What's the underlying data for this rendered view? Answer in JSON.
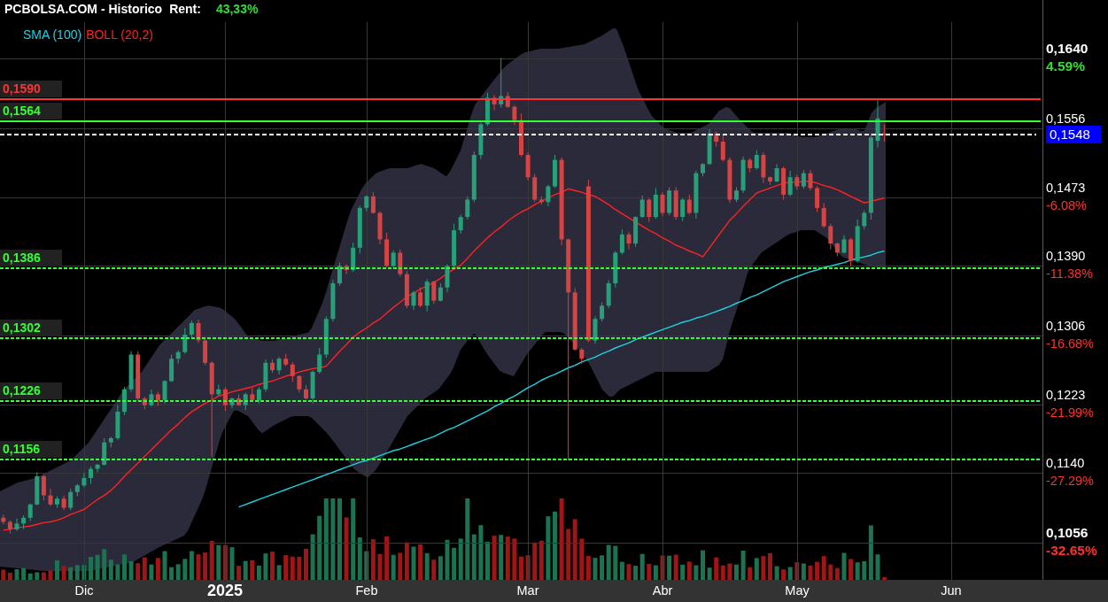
{
  "header": {
    "title": "PCBOLSA.COM - Historico",
    "rent_label": "Rent:",
    "rent_value": "43,33%"
  },
  "plot": {
    "chart_data": {
      "type": "candlestick",
      "grid": true,
      "ylim": [
        0.1011,
        0.1711
      ],
      "categories": [
        null,
        null,
        null,
        null,
        null,
        null,
        null,
        null,
        null,
        null,
        null,
        null,
        "Dic",
        null,
        null,
        null,
        null,
        null,
        null,
        null,
        null,
        null,
        null,
        null,
        null,
        null,
        null,
        null,
        null,
        null,
        null,
        null,
        null,
        "2025",
        null,
        null,
        null,
        null,
        null,
        null,
        null,
        null,
        null,
        null,
        null,
        null,
        null,
        null,
        null,
        null,
        null,
        null,
        null,
        null,
        "Feb",
        null,
        null,
        null,
        null,
        null,
        null,
        null,
        null,
        null,
        null,
        null,
        null,
        null,
        null,
        null,
        null,
        null,
        null,
        null,
        null,
        null,
        null,
        null,
        "Mar",
        null,
        null,
        null,
        null,
        null,
        null,
        null,
        null,
        null,
        null,
        null,
        null,
        null,
        null,
        null,
        null,
        null,
        null,
        null,
        "Abr",
        null,
        null,
        null,
        null,
        null,
        null,
        null,
        null,
        null,
        null,
        null,
        null,
        null,
        null,
        null,
        null,
        null,
        null,
        null,
        "May",
        null,
        null,
        null,
        null,
        null,
        null,
        null,
        null,
        null,
        null,
        null,
        null,
        null,
        null,
        null,
        null,
        null,
        null,
        null,
        null,
        null,
        null,
        "Jun",
        null,
        null,
        null,
        null,
        null,
        null,
        null,
        null,
        null,
        null,
        null,
        null,
        null
      ],
      "yticks": [
        {
          "value": 0.164,
          "label": "0,1640"
        },
        {
          "value": 0.1556,
          "label": "0,1556"
        },
        {
          "value": 0.1473,
          "label": "0,1473"
        },
        {
          "value": 0.139,
          "label": "0,1390"
        },
        {
          "value": 0.1306,
          "label": "0,1306"
        },
        {
          "value": 0.1223,
          "label": "0,1223"
        },
        {
          "value": 0.114,
          "label": "0,1140"
        },
        {
          "value": 0.1056,
          "label": "0,1056"
        }
      ],
      "ohlc": [
        [
          0.1086,
          0.109,
          0.1078,
          0.1081
        ],
        [
          0.1081,
          0.1083,
          0.1067,
          0.1072
        ],
        [
          0.1072,
          0.1085,
          0.107,
          0.1079
        ],
        [
          0.1079,
          0.1089,
          0.1072,
          0.1086
        ],
        [
          0.1086,
          0.1103,
          0.1082,
          0.1102
        ],
        [
          0.1102,
          0.1141,
          0.1101,
          0.1136
        ],
        [
          0.1136,
          0.1138,
          0.1107,
          0.1113
        ],
        [
          0.1113,
          0.1121,
          0.11,
          0.1102
        ],
        [
          0.1102,
          0.1112,
          0.1098,
          0.1109
        ],
        [
          0.1109,
          0.1113,
          0.1095,
          0.1098
        ],
        [
          0.1098,
          0.1121,
          0.1095,
          0.1117
        ],
        [
          0.1117,
          0.1127,
          0.1112,
          0.1125
        ],
        [
          0.1125,
          0.114,
          0.1123,
          0.1134
        ],
        [
          0.1134,
          0.1148,
          0.1127,
          0.1145
        ],
        [
          0.1145,
          0.1151,
          0.1141,
          0.115
        ],
        [
          0.115,
          0.1182,
          0.1149,
          0.1177
        ],
        [
          0.1177,
          0.1184,
          0.1171,
          0.1182
        ],
        [
          0.1182,
          0.1222,
          0.118,
          0.1214
        ],
        [
          0.1214,
          0.1244,
          0.121,
          0.1241
        ],
        [
          0.1241,
          0.1287,
          0.1238,
          0.1283
        ],
        [
          0.1283,
          0.1287,
          0.1227,
          0.123
        ],
        [
          0.123,
          0.1232,
          0.1217,
          0.1222
        ],
        [
          0.1222,
          0.1241,
          0.122,
          0.1235
        ],
        [
          0.1235,
          0.1238,
          0.1221,
          0.1228
        ],
        [
          0.1228,
          0.1252,
          0.1224,
          0.1251
        ],
        [
          0.1251,
          0.1283,
          0.125,
          0.1278
        ],
        [
          0.1278,
          0.1288,
          0.1272,
          0.1286
        ],
        [
          0.1286,
          0.1315,
          0.1284,
          0.1307
        ],
        [
          0.1307,
          0.1324,
          0.1303,
          0.1321
        ],
        [
          0.1321,
          0.1325,
          0.1297,
          0.13
        ],
        [
          0.13,
          0.1304,
          0.127,
          0.1273
        ],
        [
          0.1273,
          0.1275,
          0.116,
          0.1235
        ],
        [
          0.1235,
          0.1247,
          0.1233,
          0.1241
        ],
        [
          0.1241,
          0.1244,
          0.1215,
          0.1222
        ],
        [
          0.1222,
          0.1231,
          0.1218,
          0.123
        ],
        [
          0.123,
          0.1235,
          0.1221,
          0.1222
        ],
        [
          0.1222,
          0.1237,
          0.1216,
          0.1235
        ],
        [
          0.1235,
          0.1243,
          0.1226,
          0.1228
        ],
        [
          0.1228,
          0.1244,
          0.1224,
          0.1241
        ],
        [
          0.1241,
          0.1277,
          0.1238,
          0.1273
        ],
        [
          0.1273,
          0.1277,
          0.1261,
          0.1264
        ],
        [
          0.1264,
          0.128,
          0.1259,
          0.1278
        ],
        [
          0.1278,
          0.1284,
          0.1269,
          0.1271
        ],
        [
          0.1271,
          0.1274,
          0.125,
          0.1257
        ],
        [
          0.1257,
          0.1258,
          0.1237,
          0.1241
        ],
        [
          0.1241,
          0.1246,
          0.1229,
          0.123
        ],
        [
          0.123,
          0.1264,
          0.1224,
          0.1262
        ],
        [
          0.1262,
          0.1291,
          0.126,
          0.1283
        ],
        [
          0.1283,
          0.1329,
          0.1279,
          0.1326
        ],
        [
          0.1326,
          0.1373,
          0.1323,
          0.1369
        ],
        [
          0.1369,
          0.1394,
          0.1366,
          0.139
        ],
        [
          0.139,
          0.1392,
          0.138,
          0.1385
        ],
        [
          0.1385,
          0.1418,
          0.1383,
          0.1412
        ],
        [
          0.1412,
          0.1463,
          0.1405,
          0.146
        ],
        [
          0.146,
          0.1475,
          0.1456,
          0.1474
        ],
        [
          0.1474,
          0.1479,
          0.1453,
          0.1454
        ],
        [
          0.1454,
          0.1456,
          0.1416,
          0.1422
        ],
        [
          0.1422,
          0.143,
          0.1388,
          0.139
        ],
        [
          0.139,
          0.1409,
          0.1386,
          0.1406
        ],
        [
          0.1406,
          0.141,
          0.1377,
          0.138
        ],
        [
          0.138,
          0.1384,
          0.1339,
          0.1342
        ],
        [
          0.1342,
          0.136,
          0.1337,
          0.1358
        ],
        [
          0.1358,
          0.1364,
          0.134,
          0.1342
        ],
        [
          0.1342,
          0.1374,
          0.1335,
          0.1371
        ],
        [
          0.1371,
          0.1372,
          0.1344,
          0.1348
        ],
        [
          0.1348,
          0.1369,
          0.1347,
          0.1364
        ],
        [
          0.1364,
          0.1392,
          0.1358,
          0.139
        ],
        [
          0.139,
          0.1441,
          0.1388,
          0.1433
        ],
        [
          0.1433,
          0.1452,
          0.1429,
          0.1449
        ],
        [
          0.1449,
          0.1474,
          0.1446,
          0.147
        ],
        [
          0.147,
          0.1528,
          0.1467,
          0.1524
        ],
        [
          0.1524,
          0.1563,
          0.1519,
          0.1561
        ],
        [
          0.1561,
          0.1599,
          0.1559,
          0.1593
        ],
        [
          0.1593,
          0.1596,
          0.1578,
          0.1585
        ],
        [
          0.1585,
          0.1641,
          0.1581,
          0.1595
        ],
        [
          0.1595,
          0.16,
          0.1581,
          0.1582
        ],
        [
          0.1582,
          0.1584,
          0.156,
          0.1566
        ],
        [
          0.1566,
          0.1574,
          0.1522,
          0.1524
        ],
        [
          0.1524,
          0.1527,
          0.1493,
          0.1497
        ],
        [
          0.1497,
          0.1501,
          0.1467,
          0.147
        ],
        [
          0.147,
          0.1474,
          0.1464,
          0.1467
        ],
        [
          0.1467,
          0.1488,
          0.1462,
          0.1486
        ],
        [
          0.1486,
          0.1524,
          0.1484,
          0.1518
        ],
        [
          0.1518,
          0.1521,
          0.1415,
          0.1422
        ],
        [
          0.1422,
          0.1423,
          0.1155,
          0.1358
        ],
        [
          0.1358,
          0.1363,
          0.1288,
          0.1289
        ],
        [
          0.1289,
          0.1291,
          0.1272,
          0.1278
        ],
        [
          0.1486,
          0.1494,
          0.1298,
          0.13
        ],
        [
          0.13,
          0.1329,
          0.1296,
          0.1326
        ],
        [
          0.1326,
          0.1346,
          0.1323,
          0.1342
        ],
        [
          0.1342,
          0.1373,
          0.1339,
          0.1369
        ],
        [
          0.1369,
          0.1408,
          0.1364,
          0.1406
        ],
        [
          0.1406,
          0.1434,
          0.1404,
          0.1428
        ],
        [
          0.1428,
          0.1431,
          0.141,
          0.1417
        ],
        [
          0.1417,
          0.145,
          0.1413,
          0.1449
        ],
        [
          0.1449,
          0.1475,
          0.1448,
          0.147
        ],
        [
          0.147,
          0.1472,
          0.1443,
          0.1449
        ],
        [
          0.1449,
          0.1484,
          0.1447,
          0.1476
        ],
        [
          0.1476,
          0.1479,
          0.145,
          0.1454
        ],
        [
          0.1454,
          0.1485,
          0.1451,
          0.1481
        ],
        [
          0.1481,
          0.1485,
          0.1446,
          0.1449
        ],
        [
          0.1449,
          0.1472,
          0.1444,
          0.147
        ],
        [
          0.147,
          0.1476,
          0.1452,
          0.1454
        ],
        [
          0.1454,
          0.1505,
          0.1447,
          0.1502
        ],
        [
          0.1502,
          0.1514,
          0.1498,
          0.1513
        ],
        [
          0.1513,
          0.1555,
          0.1512,
          0.155
        ],
        [
          0.155,
          0.1552,
          0.1534,
          0.154
        ],
        [
          0.154,
          0.1548,
          0.1516,
          0.1518
        ],
        [
          0.1518,
          0.1521,
          0.1466,
          0.147
        ],
        [
          0.147,
          0.1485,
          0.1467,
          0.1481
        ],
        [
          0.1481,
          0.1522,
          0.1478,
          0.1518
        ],
        [
          0.1518,
          0.152,
          0.1503,
          0.1508
        ],
        [
          0.1508,
          0.153,
          0.1506,
          0.1524
        ],
        [
          0.1524,
          0.1527,
          0.149,
          0.1497
        ],
        [
          0.1497,
          0.1498,
          0.1488,
          0.1492
        ],
        [
          0.1492,
          0.1513,
          0.1491,
          0.1508
        ],
        [
          0.1508,
          0.151,
          0.147,
          0.1476
        ],
        [
          0.1476,
          0.1505,
          0.1474,
          0.1497
        ],
        [
          0.1497,
          0.15,
          0.1482,
          0.1486
        ],
        [
          0.1486,
          0.1506,
          0.1483,
          0.1502
        ],
        [
          0.1502,
          0.1506,
          0.1481,
          0.1484
        ],
        [
          0.1484,
          0.1486,
          0.1455,
          0.146
        ],
        [
          0.146,
          0.1466,
          0.1436,
          0.1438
        ],
        [
          0.1438,
          0.1441,
          0.141,
          0.1417
        ],
        [
          0.1417,
          0.1418,
          0.1402,
          0.1406
        ],
        [
          0.1406,
          0.1427,
          0.1405,
          0.1422
        ],
        [
          0.1422,
          0.1424,
          0.139,
          0.1396
        ],
        [
          0.1396,
          0.1446,
          0.1394,
          0.1438
        ],
        [
          0.1438,
          0.1457,
          0.1434,
          0.1454
        ],
        [
          0.1454,
          0.155,
          0.1446,
          0.1545
        ],
        [
          0.1541,
          0.159,
          0.1533,
          0.1568
        ],
        [
          0.155,
          0.1561,
          0.154,
          0.1548
        ],
        null,
        null,
        null,
        null,
        null,
        null,
        null,
        null,
        null,
        null,
        null,
        null,
        null,
        null,
        null,
        null,
        null,
        null,
        null,
        null,
        null,
        null,
        null
      ],
      "series": [
        {
          "name": "SMA (100)",
          "type": "line",
          "color": "#1ed2e2",
          "values": [
            null,
            null,
            null,
            null,
            null,
            null,
            null,
            null,
            null,
            null,
            null,
            null,
            null,
            null,
            null,
            null,
            null,
            null,
            null,
            null,
            null,
            null,
            null,
            null,
            null,
            null,
            null,
            null,
            null,
            null,
            null,
            null,
            null,
            null,
            null,
            0.1099,
            0.1102,
            0.1105,
            0.1108,
            0.1111,
            0.1114,
            0.1117,
            0.112,
            0.1123,
            0.1126,
            0.1129,
            0.1132,
            0.1135,
            0.1138,
            0.1141,
            0.1144,
            0.1147,
            0.115,
            0.1153,
            0.1155,
            0.1158,
            0.1161,
            0.1164,
            0.1167,
            0.1169,
            0.1172,
            0.1175,
            0.1178,
            0.1181,
            0.1184,
            0.1188,
            0.1192,
            0.1195,
            0.1199,
            0.1203,
            0.1207,
            0.1211,
            0.1215,
            0.122,
            0.1224,
            0.1229,
            0.1233,
            0.1238,
            0.1243,
            0.1247,
            0.1252,
            0.1256,
            0.1259,
            0.1263,
            0.1267,
            0.127,
            0.1274,
            0.1277,
            0.128,
            0.1284,
            0.1287,
            0.1291,
            0.1294,
            0.1297,
            0.1301,
            0.1304,
            0.1307,
            0.131,
            0.1313,
            0.1316,
            0.1319,
            0.1322,
            0.1324,
            0.1327,
            0.1329,
            0.1332,
            0.1335,
            0.1338,
            0.1341,
            0.1345,
            0.1348,
            0.1352,
            0.1355,
            0.1359,
            0.1363,
            0.1367,
            0.1371,
            0.1374,
            0.1377,
            0.138,
            0.1383,
            0.1385,
            0.1388,
            0.139,
            0.1392,
            0.1394,
            0.1397,
            0.1399,
            0.1401,
            0.1403,
            0.1406,
            0.1408,
            null,
            null,
            null,
            null,
            null,
            null,
            null,
            null,
            null,
            null,
            null,
            null,
            null,
            null,
            null,
            null,
            null,
            null,
            null,
            null,
            null,
            null,
            null
          ]
        },
        {
          "name": "BOLL (20,2)",
          "type": "line",
          "color": "#ff2222",
          "values": [
            0.1071,
            0.1072,
            0.1074,
            0.1075,
            0.1076,
            0.1078,
            0.108,
            0.1081,
            0.1083,
            0.1086,
            0.109,
            0.1093,
            0.1096,
            0.1102,
            0.1108,
            0.1113,
            0.1119,
            0.1127,
            0.1136,
            0.1144,
            0.1152,
            0.116,
            0.1168,
            0.1176,
            0.1184,
            0.1192,
            0.1199,
            0.1207,
            0.1214,
            0.1219,
            0.1224,
            0.1228,
            0.1233,
            0.1235,
            0.1238,
            0.124,
            0.1242,
            0.1244,
            0.1247,
            0.1249,
            0.1251,
            0.1254,
            0.1257,
            0.1259,
            0.1262,
            0.1264,
            0.1266,
            0.1267,
            0.1269,
            0.1278,
            0.1287,
            0.1295,
            0.1304,
            0.131,
            0.1315,
            0.1321,
            0.1326,
            0.1333,
            0.134,
            0.1346,
            0.1353,
            0.1357,
            0.1362,
            0.1366,
            0.137,
            0.1375,
            0.1381,
            0.1386,
            0.1391,
            0.1399,
            0.1408,
            0.1416,
            0.1424,
            0.1431,
            0.1437,
            0.1444,
            0.145,
            0.1455,
            0.1459,
            0.1464,
            0.1468,
            0.1472,
            0.1476,
            0.1479,
            0.1483,
            0.1481,
            0.1479,
            0.1476,
            0.1474,
            0.1469,
            0.1464,
            0.1458,
            0.1453,
            0.1448,
            0.1443,
            0.1438,
            0.1433,
            0.1429,
            0.1424,
            0.142,
            0.1415,
            0.1412,
            0.1408,
            0.1405,
            0.1401,
            0.1412,
            0.1423,
            0.1434,
            0.1445,
            0.1453,
            0.1462,
            0.147,
            0.1478,
            0.1481,
            0.1484,
            0.1487,
            0.149,
            0.1491,
            0.1491,
            0.1492,
            0.1492,
            0.149,
            0.1487,
            0.1485,
            0.1482,
            0.1478,
            0.1474,
            0.147,
            0.1466,
            0.1468,
            0.147,
            0.1472,
            null,
            null,
            null,
            null,
            null,
            null,
            null,
            null,
            null,
            null,
            null,
            null,
            null,
            null,
            null,
            null,
            null,
            null,
            null,
            null,
            null,
            null,
            null
          ]
        }
      ]
    }
  },
  "time_axis": [
    {
      "kind": "month"
    },
    {
      "kind": "year"
    },
    {
      "kind": "month"
    },
    {
      "kind": "month"
    },
    {
      "kind": "month"
    },
    {
      "kind": "month"
    },
    {
      "kind": "month"
    }
  ],
  "price_axis": [
    {
      "bold": true,
      "change": "4.59%",
      "color": "#33dd33"
    },
    {
      "bold": false
    },
    {
      "bold": false,
      "change": "-6.08%",
      "color": "#ff3030"
    },
    {
      "bold": false,
      "change": "-11.38%",
      "color": "#ff3030"
    },
    {
      "bold": false,
      "change": "-16.68%",
      "color": "#ff3030"
    },
    {
      "bold": false,
      "change": "-21.99%",
      "color": "#ff3030"
    },
    {
      "bold": false,
      "change": "-27.29%",
      "color": "#ff3030"
    },
    {
      "bold": true,
      "change": "-32.65%",
      "color": "#ff3030"
    }
  ],
  "levels": [
    {
      "label": "0,1590",
      "color": "#ff3333",
      "dashed": false
    },
    {
      "label": "0,1564",
      "color": "#33ff33",
      "dashed": false
    },
    {
      "label": "0,1386",
      "color": "#33ff33",
      "dashed": true
    },
    {
      "label": "0,1302",
      "color": "#33ff33",
      "dashed": true
    },
    {
      "label": "0,1226",
      "color": "#33ff33",
      "dashed": true
    },
    {
      "label": "0,1156",
      "color": "#33ff33",
      "dashed": true
    }
  ],
  "last_price": {
    "label": "0,1548"
  }
}
